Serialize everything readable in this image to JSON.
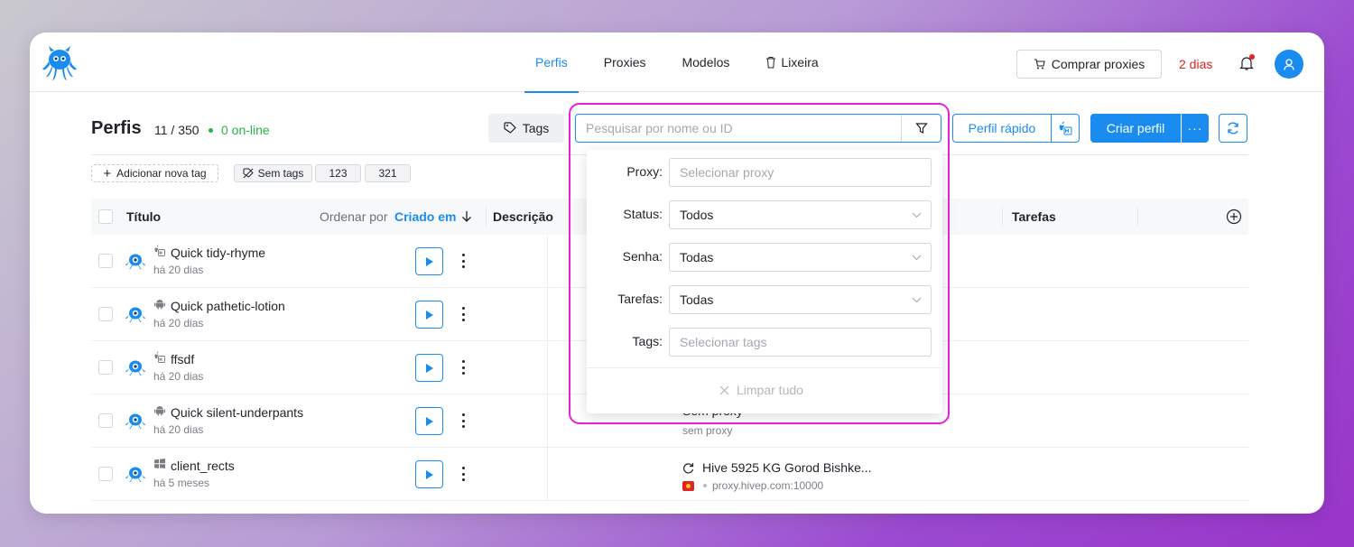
{
  "nav": {
    "profiles": "Perfis",
    "proxies": "Proxies",
    "models": "Modelos",
    "trash": "Lixeira"
  },
  "topbar": {
    "buy_proxies": "Comprar proxies",
    "days_left": "2 dias"
  },
  "header": {
    "title": "Perfis",
    "count": "11 / 350",
    "online": "0 on-line"
  },
  "toolbar": {
    "tags": "Tags",
    "search_placeholder": "Pesquisar por nome ou ID",
    "quick_profile": "Perfil rápido",
    "create_profile": "Criar perfil",
    "more": "···"
  },
  "tag_bar": {
    "add_tag": "Adicionar nova tag",
    "no_tags": "Sem tags",
    "tag1": "123",
    "tag2": "321"
  },
  "table": {
    "col_title": "Título",
    "sort_label": "Ordenar por",
    "sort_value": "Criado em",
    "col_description": "Descrição",
    "col_tasks": "Tarefas"
  },
  "rows": [
    {
      "os": "macos",
      "title": "Quick tidy-rhyme",
      "subtitle": "há 20 dias"
    },
    {
      "os": "android",
      "title": "Quick pathetic-lotion",
      "subtitle": "há 20 dias"
    },
    {
      "os": "macos",
      "title": "ffsdf",
      "subtitle": "há 20 dias"
    },
    {
      "os": "android",
      "title": "Quick silent-underpants",
      "subtitle": "há 20 dias",
      "proxy_title": "Sem proxy",
      "proxy_sub": "sem proxy"
    },
    {
      "os": "windows",
      "title": "client_rects",
      "subtitle": "há 5 meses",
      "proxy_title": "Hive 5925 KG Gorod Bishke...",
      "proxy_sub": "proxy.hivep.com:10000"
    }
  ],
  "filter": {
    "proxy_label": "Proxy:",
    "proxy_placeholder": "Selecionar proxy",
    "status_label": "Status:",
    "status_value": "Todos",
    "password_label": "Senha:",
    "password_value": "Todas",
    "tasks_label": "Tarefas:",
    "tasks_value": "Todas",
    "tags_label": "Tags:",
    "tags_placeholder": "Selecionar tags",
    "clear_all": "Limpar tudo"
  },
  "colors": {
    "accent": "#1a8cf0",
    "danger": "#e02424",
    "online": "#28b34a",
    "highlight": "#e820d6"
  }
}
